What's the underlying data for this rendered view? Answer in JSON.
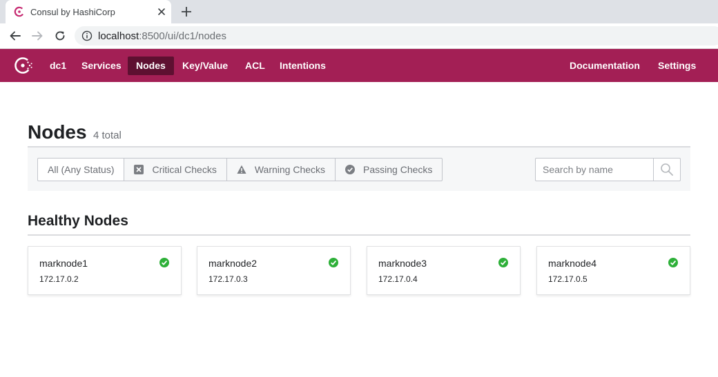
{
  "browser": {
    "tab_title": "Consul by HashiCorp",
    "url_host": "localhost",
    "url_rest": ":8500/ui/dc1/nodes"
  },
  "header": {
    "datacenter": "dc1",
    "nav": [
      "Services",
      "Nodes",
      "Key/Value",
      "ACL",
      "Intentions"
    ],
    "active": "Nodes",
    "right_nav": [
      "Documentation",
      "Settings"
    ],
    "brand_color": "#a31f55",
    "active_color": "#5e1031"
  },
  "page": {
    "title": "Nodes",
    "count": "4 total"
  },
  "filters": {
    "options": [
      "All (Any Status)",
      "Critical Checks",
      "Warning Checks",
      "Passing Checks"
    ],
    "selected": "All (Any Status)",
    "search_placeholder": "Search by name"
  },
  "section": {
    "title": "Healthy Nodes"
  },
  "nodes": [
    {
      "name": "marknode1",
      "address": "172.17.0.2",
      "status": "passing"
    },
    {
      "name": "marknode2",
      "address": "172.17.0.3",
      "status": "passing"
    },
    {
      "name": "marknode3",
      "address": "172.17.0.4",
      "status": "passing"
    },
    {
      "name": "marknode4",
      "address": "172.17.0.5",
      "status": "passing"
    }
  ],
  "colors": {
    "passing": "#2eb039"
  }
}
